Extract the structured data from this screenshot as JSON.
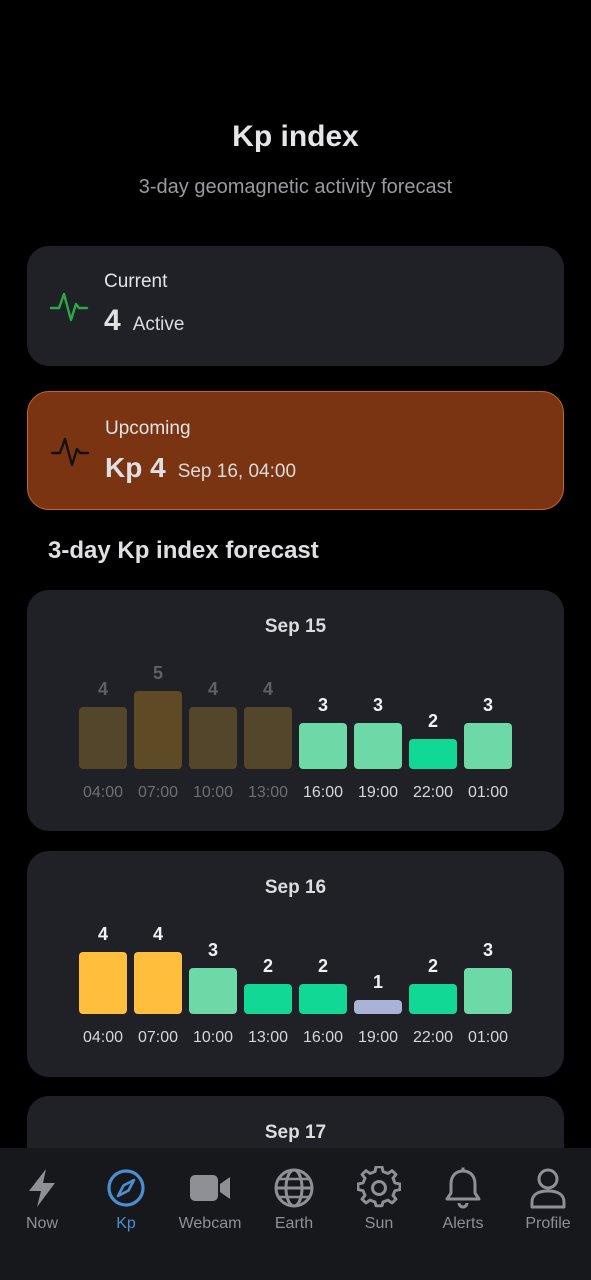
{
  "header": {
    "title": "Kp index",
    "subtitle": "3-day geomagnetic activity forecast"
  },
  "current": {
    "label": "Current",
    "value": "4",
    "status": "Active",
    "icon": "activity-pulse-icon",
    "icon_color": "#2aa84a"
  },
  "upcoming": {
    "label": "Upcoming",
    "value": "Kp 4",
    "time": "Sep 16, 04:00",
    "icon": "activity-pulse-icon",
    "background": "#7a3412"
  },
  "forecast": {
    "section_title": "3-day Kp index forecast",
    "days": [
      {
        "date": "Sep 15",
        "bars": [
          {
            "time": "04:00",
            "kp": 4,
            "past": true
          },
          {
            "time": "07:00",
            "kp": 5,
            "past": true
          },
          {
            "time": "10:00",
            "kp": 4,
            "past": true
          },
          {
            "time": "13:00",
            "kp": 4,
            "past": true
          },
          {
            "time": "16:00",
            "kp": 3,
            "past": false
          },
          {
            "time": "19:00",
            "kp": 3,
            "past": false
          },
          {
            "time": "22:00",
            "kp": 2,
            "past": false
          },
          {
            "time": "01:00",
            "kp": 3,
            "past": false
          }
        ]
      },
      {
        "date": "Sep 16",
        "bars": [
          {
            "time": "04:00",
            "kp": 4,
            "past": false
          },
          {
            "time": "07:00",
            "kp": 4,
            "past": false
          },
          {
            "time": "10:00",
            "kp": 3,
            "past": false
          },
          {
            "time": "13:00",
            "kp": 2,
            "past": false
          },
          {
            "time": "16:00",
            "kp": 2,
            "past": false
          },
          {
            "time": "19:00",
            "kp": 1,
            "past": false
          },
          {
            "time": "22:00",
            "kp": 2,
            "past": false
          },
          {
            "time": "01:00",
            "kp": 3,
            "past": false
          }
        ]
      },
      {
        "date": "Sep 17",
        "bars": []
      }
    ],
    "colors": {
      "kp1": "#a9b3d6",
      "kp2": "#12d896",
      "kp3": "#6cd9a6",
      "kp4": "#ffbf3c",
      "kp5": "#ff9a3c",
      "past4": "#54462b",
      "past5": "#5f4a26"
    }
  },
  "tabbar": {
    "items": [
      {
        "label": "Now",
        "icon": "lightning-icon",
        "active": false
      },
      {
        "label": "Kp",
        "icon": "compass-icon",
        "active": true
      },
      {
        "label": "Webcam",
        "icon": "video-camera-icon",
        "active": false
      },
      {
        "label": "Earth",
        "icon": "globe-icon",
        "active": false
      },
      {
        "label": "Sun",
        "icon": "gear-sun-icon",
        "active": false
      },
      {
        "label": "Alerts",
        "icon": "bell-icon",
        "active": false
      },
      {
        "label": "Profile",
        "icon": "person-icon",
        "active": false
      }
    ]
  }
}
